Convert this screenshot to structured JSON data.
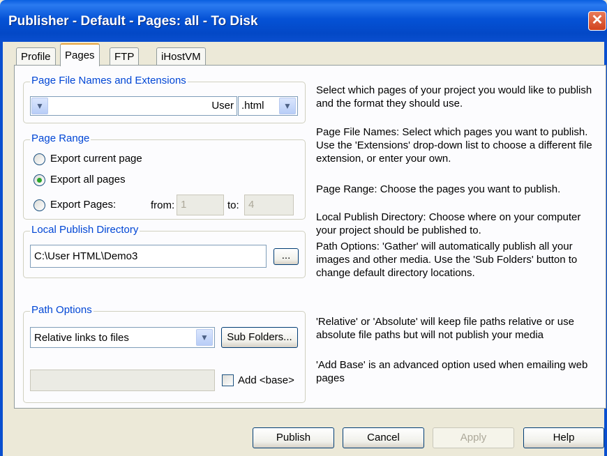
{
  "window": {
    "title": "Publisher - Default - Pages: all - To Disk",
    "close_glyph": "✕"
  },
  "tabs": [
    "Profile",
    "Pages",
    "FTP",
    "iHostVM"
  ],
  "page_names": {
    "label": "Page File Names and Extensions",
    "selected": "User",
    "extension": ".html"
  },
  "page_range": {
    "label": "Page Range",
    "options": [
      "Export current page",
      "Export all pages",
      "Export Pages:"
    ],
    "selected_index": 1,
    "from_label": "from:",
    "from_value": "1",
    "to_label": "to:",
    "to_value": "4"
  },
  "publish_dir": {
    "label": "Local Publish Directory",
    "value": "C:\\User HTML\\Demo3",
    "browse_label": "..."
  },
  "path_options": {
    "label": "Path Options",
    "selected": "Relative links to files",
    "sub_folders_label": "Sub Folders...",
    "base_value": "",
    "add_base_label": "Add <base>",
    "add_base_checked": false
  },
  "help": [
    "Select which pages of your project you would like to publish and the format they should use.",
    "Page File Names: Select which pages you want to publish. Use the 'Extensions' drop-down list to choose a different file extension, or enter your own.",
    "Page Range: Choose the pages you want to publish.",
    "Local Publish Directory: Choose where on your computer your project should be published to.",
    "Path Options: 'Gather' will automatically publish all your images and other media. Use the 'Sub Folders' button to change default directory locations.",
    "'Relative' or 'Absolute' will keep file paths relative or use absolute file paths but will not publish your media",
    "'Add Base' is an advanced option used when emailing web pages"
  ],
  "buttons": {
    "publish": "Publish",
    "cancel": "Cancel",
    "apply": "Apply",
    "help": "Help"
  },
  "colors": {
    "title_bar": "#0552d6",
    "group_label": "#0046d5",
    "radio_dot": "#2aa62a",
    "dialog_bg": "#ece9d8"
  }
}
